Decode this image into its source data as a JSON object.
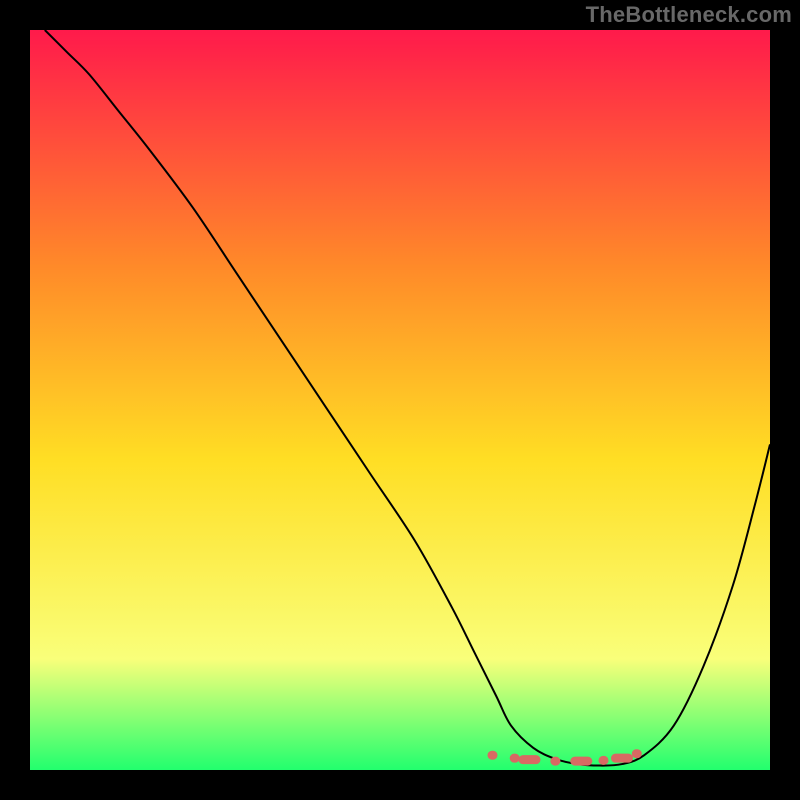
{
  "watermark": "TheBottleneck.com",
  "chart_data": {
    "type": "line",
    "title": "",
    "xlabel": "",
    "ylabel": "",
    "xlim": [
      0,
      100
    ],
    "ylim": [
      0,
      100
    ],
    "grid": false,
    "legend": false,
    "background_gradient": {
      "top": "#ff1a4b",
      "upper_mid": "#ff8a29",
      "mid": "#ffde24",
      "lower_mid": "#f9ff7a",
      "bottom": "#22ff6e"
    },
    "series": [
      {
        "name": "bottleneck-curve",
        "color": "#000000",
        "stroke_width": 2,
        "x": [
          2,
          5,
          8,
          12,
          16,
          22,
          28,
          34,
          40,
          46,
          52,
          57,
          60,
          63,
          65,
          68,
          71,
          74,
          77,
          80,
          83,
          87,
          91,
          95,
          98,
          100
        ],
        "y": [
          100,
          97,
          94,
          89,
          84,
          76,
          67,
          58,
          49,
          40,
          31,
          22,
          16,
          10,
          6,
          3,
          1.5,
          0.8,
          0.6,
          0.8,
          2,
          6,
          14,
          25,
          36,
          44
        ]
      }
    ],
    "markers": {
      "name": "optimal-band",
      "color": "#d86a63",
      "shape": "rounded-dash",
      "x": [
        62.5,
        65.5,
        67.5,
        71.0,
        74.5,
        77.5,
        80.0,
        82.0
      ],
      "y": [
        2.0,
        1.6,
        1.4,
        1.2,
        1.2,
        1.3,
        1.6,
        2.2
      ]
    }
  }
}
